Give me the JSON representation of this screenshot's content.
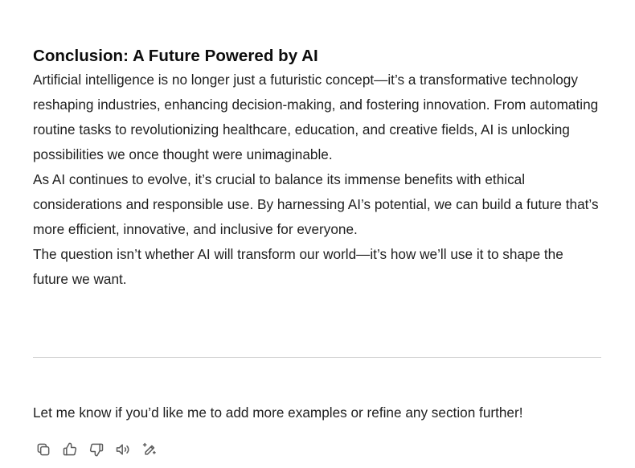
{
  "message": {
    "heading": "Conclusion: A Future Powered by AI",
    "paragraphs": [
      "Artificial intelligence is no longer just a futuristic concept—it’s a transformative technology reshaping industries, enhancing decision-making, and fostering innovation. From automating routine tasks to revolutionizing healthcare, education, and creative fields, AI is unlocking possibilities we once thought were unimaginable.",
      "As AI continues to evolve, it’s crucial to balance its immense benefits with ethical considerations and responsible use. By harnessing AI’s potential, we can build a future that’s more efficient, innovative, and inclusive for everyone.",
      "The question isn’t whether AI will transform our world—it’s how we’ll use it to shape the future we want."
    ],
    "followup": "Let me know if you’d like me to add more examples or refine any section further!"
  },
  "actions": [
    {
      "icon": "copy-icon"
    },
    {
      "icon": "thumbs-up-icon"
    },
    {
      "icon": "thumbs-down-icon"
    },
    {
      "icon": "read-aloud-icon"
    },
    {
      "icon": "edit-icon"
    }
  ],
  "colors": {
    "text": "#0d0d0d",
    "body_text": "#1f1f1f",
    "icon": "#5d5d5d",
    "divider": "#d3d3d3"
  }
}
